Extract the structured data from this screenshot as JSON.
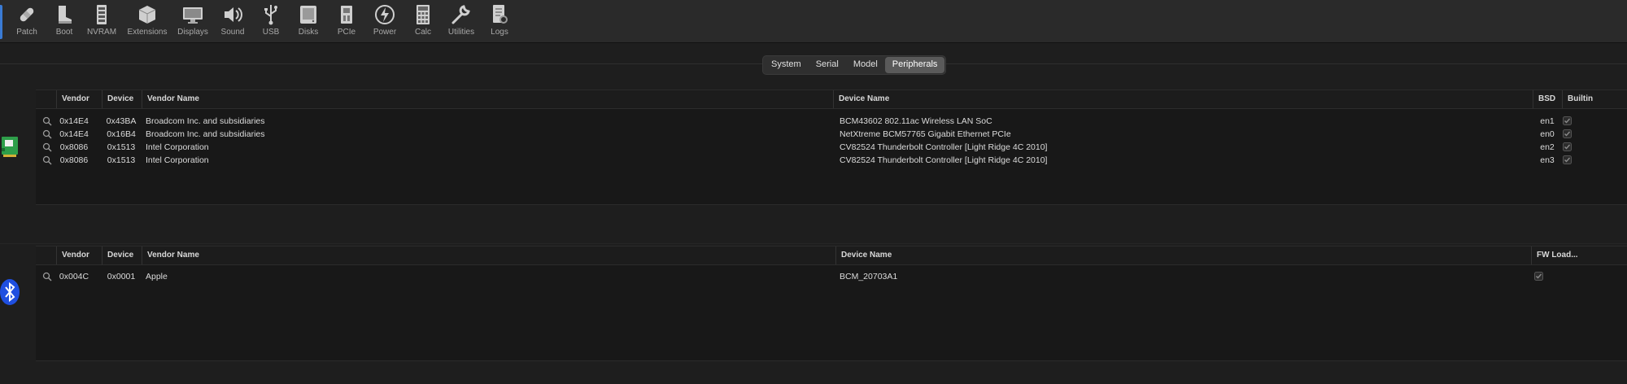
{
  "toolbar": {
    "items": [
      {
        "label": "Patch",
        "icon": "patch-icon"
      },
      {
        "label": "Boot",
        "icon": "boot-icon"
      },
      {
        "label": "NVRAM",
        "icon": "nvram-icon"
      },
      {
        "label": "Extensions",
        "icon": "extensions-icon"
      },
      {
        "label": "Displays",
        "icon": "displays-icon"
      },
      {
        "label": "Sound",
        "icon": "sound-icon"
      },
      {
        "label": "USB",
        "icon": "usb-icon"
      },
      {
        "label": "Disks",
        "icon": "disks-icon"
      },
      {
        "label": "PCIe",
        "icon": "pcie-icon"
      },
      {
        "label": "Power",
        "icon": "power-icon"
      },
      {
        "label": "Calc",
        "icon": "calc-icon"
      },
      {
        "label": "Utilities",
        "icon": "utilities-icon"
      },
      {
        "label": "Logs",
        "icon": "logs-icon"
      }
    ]
  },
  "tabs": [
    {
      "label": "System",
      "active": false
    },
    {
      "label": "Serial",
      "active": false
    },
    {
      "label": "Model",
      "active": false
    },
    {
      "label": "Peripherals",
      "active": true
    }
  ],
  "network_table": {
    "headers": {
      "vendor": "Vendor",
      "device": "Device",
      "vendor_name": "Vendor Name",
      "device_name": "Device Name",
      "bsd": "BSD",
      "builtin": "Builtin"
    },
    "rows": [
      {
        "vendor": "0x14E4",
        "device": "0x43BA",
        "vendor_name": "Broadcom Inc. and subsidiaries",
        "device_name": "BCM43602 802.11ac Wireless LAN SoC",
        "bsd": "en1",
        "builtin": true
      },
      {
        "vendor": "0x14E4",
        "device": "0x16B4",
        "vendor_name": "Broadcom Inc. and subsidiaries",
        "device_name": "NetXtreme BCM57765 Gigabit Ethernet PCIe",
        "bsd": "en0",
        "builtin": true
      },
      {
        "vendor": "0x8086",
        "device": "0x1513",
        "vendor_name": "Intel Corporation",
        "device_name": "CV82524 Thunderbolt Controller [Light Ridge 4C 2010]",
        "bsd": "en2",
        "builtin": true
      },
      {
        "vendor": "0x8086",
        "device": "0x1513",
        "vendor_name": "Intel Corporation",
        "device_name": "CV82524 Thunderbolt Controller [Light Ridge 4C 2010]",
        "bsd": "en3",
        "builtin": true
      }
    ]
  },
  "bluetooth_table": {
    "headers": {
      "vendor": "Vendor",
      "device": "Device",
      "vendor_name": "Vendor Name",
      "device_name": "Device Name",
      "fw_load": "FW Load..."
    },
    "rows": [
      {
        "vendor": "0x004C",
        "device": "0x0001",
        "vendor_name": "Apple",
        "device_name": "BCM_20703A1",
        "fw_load": true
      }
    ]
  },
  "colors": {
    "accent": "#3a7bd5",
    "bluetooth": "#1f4fe0",
    "network_card": "#2e9e4a"
  }
}
